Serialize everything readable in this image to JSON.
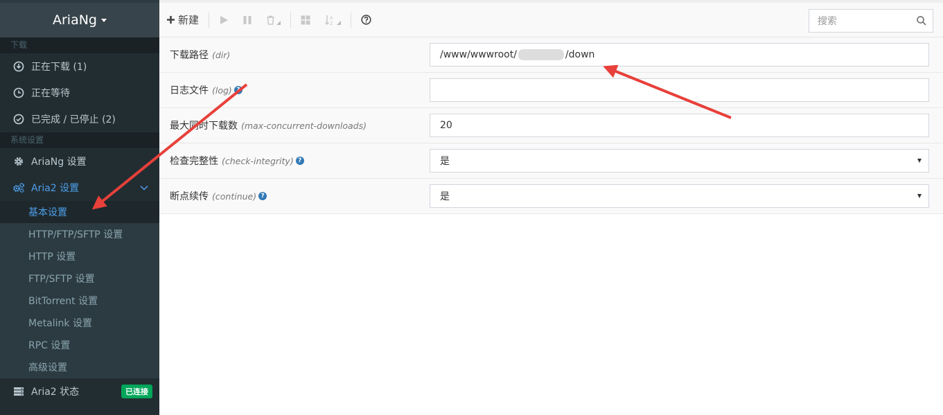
{
  "app": {
    "title": "AriaNg"
  },
  "sidebar": {
    "sections": [
      {
        "header": "下载"
      },
      {
        "header": "系统设置"
      }
    ],
    "downloads": [
      {
        "label": "正在下载 (1)",
        "icon": "download-circle-icon"
      },
      {
        "label": "正在等待",
        "icon": "clock-icon"
      },
      {
        "label": "已完成 / 已停止 (2)",
        "icon": "check-circle-icon"
      }
    ],
    "settings": [
      {
        "label": "AriaNg 设置",
        "icon": "gear-icon"
      },
      {
        "label": "Aria2 设置",
        "icon": "gears-icon"
      }
    ],
    "sub_items": [
      {
        "label": "基本设置"
      },
      {
        "label": "HTTP/FTP/SFTP 设置"
      },
      {
        "label": "HTTP 设置"
      },
      {
        "label": "FTP/SFTP 设置"
      },
      {
        "label": "BitTorrent 设置"
      },
      {
        "label": "Metalink 设置"
      },
      {
        "label": "RPC 设置"
      },
      {
        "label": "高级设置"
      }
    ],
    "status": {
      "label": "Aria2 状态",
      "badge": "已连接",
      "badge_color": "#00a65a"
    }
  },
  "toolbar": {
    "new_label": "新建",
    "search_placeholder": "搜索"
  },
  "options": [
    {
      "label": "下载路径",
      "key": "(dir)",
      "value": "/www/wwwroot/",
      "value_suffix": "/down",
      "type": "text",
      "help": false
    },
    {
      "label": "日志文件",
      "key": "(log)",
      "value": "",
      "type": "text",
      "help": true
    },
    {
      "label": "最大同时下载数",
      "key": "(max-concurrent-downloads)",
      "value": "20",
      "type": "text",
      "help": false
    },
    {
      "label": "检查完整性",
      "key": "(check-integrity)",
      "value": "是",
      "type": "select",
      "help": true
    },
    {
      "label": "断点续传",
      "key": "(continue)",
      "value": "是",
      "type": "select",
      "help": true
    }
  ],
  "colors": {
    "accent": "#4d9ee8",
    "sidebar_bg": "#222d32",
    "annotation": "#e8403a"
  }
}
